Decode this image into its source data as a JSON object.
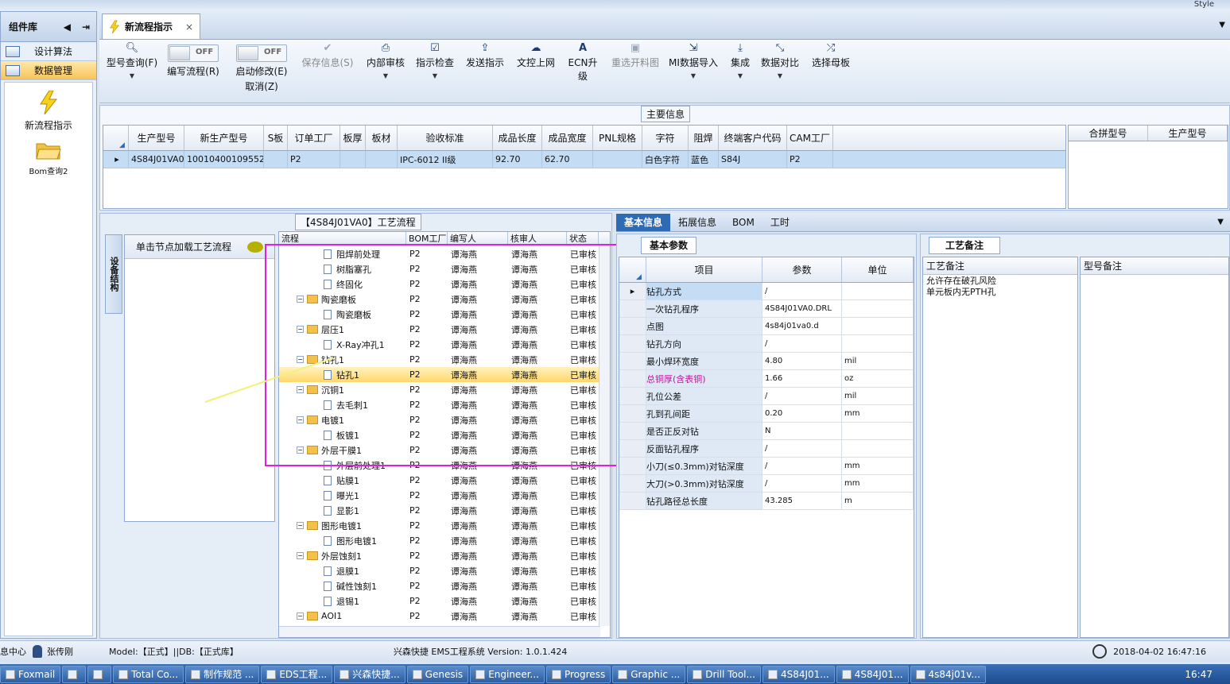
{
  "window": {
    "style_label": "Style"
  },
  "sidebar": {
    "title": "组件库",
    "prev": "◀",
    "pin": "⇥",
    "buttons": [
      {
        "label": "设计算法"
      },
      {
        "label": "数据管理"
      }
    ],
    "items": [
      {
        "label": "新流程指示"
      },
      {
        "label": "Bom查询2"
      }
    ]
  },
  "tab": {
    "label": "新流程指示",
    "close": "×",
    "menu": "▼"
  },
  "toolbar": {
    "model_query": "型号查询(F)",
    "edit_flow": "编写流程(R)",
    "start_modify": "启动修改(E)",
    "cancel": "取消(Z)",
    "off": "OFF",
    "save": "保存信息(S)",
    "internal_review": "内部审核",
    "check": "指示检查",
    "send": "发送指示",
    "upload": "文控上网",
    "ecn": "ECN升级",
    "reselect": "重选开料图",
    "mi_import": "MI数据导入",
    "integrate": "集成",
    "compare": "数据对比",
    "select_board": "选择母板"
  },
  "main_info": {
    "title": "主要信息",
    "columns": [
      "生产型号",
      "新生产型号",
      "S板",
      "订单工厂",
      "板厚",
      "板材",
      "验收标准",
      "成品长度",
      "成品宽度",
      "PNL规格",
      "字符",
      "阻焊",
      "终端客户代码",
      "CAM工厂"
    ],
    "row": [
      "4S84J01VA0",
      "10010400109552",
      "",
      "P2",
      "",
      "",
      "IPC-6012 II级",
      "92.70",
      "62.70",
      "",
      "白色字符",
      "蓝色",
      "S84J",
      "P2"
    ],
    "side_columns": [
      "合拼型号",
      "生产型号"
    ]
  },
  "process": {
    "title": "【4S84J01VA0】工艺流程",
    "side_tab": "设备结构",
    "node_hint": "单击节点加载工艺流程",
    "columns": [
      "流程",
      "BOM工厂",
      "编写人",
      "核审人",
      "状态"
    ],
    "rows": [
      {
        "name": "阻焊前处理",
        "level": 2,
        "factory": "P2",
        "writer": "谭海燕",
        "reviewer": "谭海燕",
        "status": "已审核"
      },
      {
        "name": "树脂塞孔",
        "level": 2,
        "factory": "P2",
        "writer": "谭海燕",
        "reviewer": "谭海燕",
        "status": "已审核"
      },
      {
        "name": "终固化",
        "level": 2,
        "factory": "P2",
        "writer": "谭海燕",
        "reviewer": "谭海燕",
        "status": "已审核"
      },
      {
        "name": "陶瓷磨板",
        "level": 1,
        "factory": "P2",
        "writer": "谭海燕",
        "reviewer": "谭海燕",
        "status": "已审核"
      },
      {
        "name": "陶瓷磨板",
        "level": 2,
        "factory": "P2",
        "writer": "谭海燕",
        "reviewer": "谭海燕",
        "status": "已审核"
      },
      {
        "name": "层压1",
        "level": 1,
        "factory": "P2",
        "writer": "谭海燕",
        "reviewer": "谭海燕",
        "status": "已审核"
      },
      {
        "name": "X-Ray冲孔1",
        "level": 2,
        "factory": "P2",
        "writer": "谭海燕",
        "reviewer": "谭海燕",
        "status": "已审核"
      },
      {
        "name": "钻孔1",
        "level": 1,
        "factory": "P2",
        "writer": "谭海燕",
        "reviewer": "谭海燕",
        "status": "已审核"
      },
      {
        "name": "钻孔1",
        "level": 2,
        "factory": "P2",
        "writer": "谭海燕",
        "reviewer": "谭海燕",
        "status": "已审核",
        "selected": true
      },
      {
        "name": "沉铜1",
        "level": 1,
        "factory": "P2",
        "writer": "谭海燕",
        "reviewer": "谭海燕",
        "status": "已审核"
      },
      {
        "name": "去毛刺1",
        "level": 2,
        "factory": "P2",
        "writer": "谭海燕",
        "reviewer": "谭海燕",
        "status": "已审核"
      },
      {
        "name": "电镀1",
        "level": 1,
        "factory": "P2",
        "writer": "谭海燕",
        "reviewer": "谭海燕",
        "status": "已审核"
      },
      {
        "name": "板镀1",
        "level": 2,
        "factory": "P2",
        "writer": "谭海燕",
        "reviewer": "谭海燕",
        "status": "已审核"
      },
      {
        "name": "外层干膜1",
        "level": 1,
        "factory": "P2",
        "writer": "谭海燕",
        "reviewer": "谭海燕",
        "status": "已审核"
      },
      {
        "name": "外层前处理1",
        "level": 2,
        "factory": "P2",
        "writer": "谭海燕",
        "reviewer": "谭海燕",
        "status": "已审核"
      },
      {
        "name": "贴膜1",
        "level": 2,
        "factory": "P2",
        "writer": "谭海燕",
        "reviewer": "谭海燕",
        "status": "已审核"
      },
      {
        "name": "曝光1",
        "level": 2,
        "factory": "P2",
        "writer": "谭海燕",
        "reviewer": "谭海燕",
        "status": "已审核"
      },
      {
        "name": "显影1",
        "level": 2,
        "factory": "P2",
        "writer": "谭海燕",
        "reviewer": "谭海燕",
        "status": "已审核"
      },
      {
        "name": "图形电镀1",
        "level": 1,
        "factory": "P2",
        "writer": "谭海燕",
        "reviewer": "谭海燕",
        "status": "已审核"
      },
      {
        "name": "图形电镀1",
        "level": 2,
        "factory": "P2",
        "writer": "谭海燕",
        "reviewer": "谭海燕",
        "status": "已审核"
      },
      {
        "name": "外层蚀刻1",
        "level": 1,
        "factory": "P2",
        "writer": "谭海燕",
        "reviewer": "谭海燕",
        "status": "已审核"
      },
      {
        "name": "退膜1",
        "level": 2,
        "factory": "P2",
        "writer": "谭海燕",
        "reviewer": "谭海燕",
        "status": "已审核"
      },
      {
        "name": "碱性蚀刻1",
        "level": 2,
        "factory": "P2",
        "writer": "谭海燕",
        "reviewer": "谭海燕",
        "status": "已审核"
      },
      {
        "name": "退锡1",
        "level": 2,
        "factory": "P2",
        "writer": "谭海燕",
        "reviewer": "谭海燕",
        "status": "已审核"
      },
      {
        "name": "AOI1",
        "level": 1,
        "factory": "P2",
        "writer": "谭海燕",
        "reviewer": "谭海燕",
        "status": "已审核"
      }
    ]
  },
  "right_tabs": [
    {
      "label": "基本信息",
      "active": true
    },
    {
      "label": "拓展信息"
    },
    {
      "label": "BOM"
    },
    {
      "label": "工时"
    }
  ],
  "right_menu": "▼",
  "params": {
    "title": "基本参数",
    "columns": [
      "项目",
      "参数",
      "单位"
    ],
    "rows": [
      {
        "item": "钻孔方式",
        "value": "/",
        "unit": "",
        "selected": true
      },
      {
        "item": "一次钻孔程序",
        "value": "4S84J01VA0.DRL",
        "unit": ""
      },
      {
        "item": "点图",
        "value": "4s84j01va0.d",
        "unit": ""
      },
      {
        "item": "钻孔方向",
        "value": "/",
        "unit": ""
      },
      {
        "item": "最小焊环宽度",
        "value": "4.80",
        "unit": "mil"
      },
      {
        "item": "总铜厚(含表铜)",
        "value": "1.66",
        "unit": "oz",
        "highlight": true
      },
      {
        "item": "孔位公差",
        "value": "/",
        "unit": "mil"
      },
      {
        "item": "孔到孔间距",
        "value": "0.20",
        "unit": "mm"
      },
      {
        "item": "是否正反对钻",
        "value": "N",
        "unit": ""
      },
      {
        "item": "反面钻孔程序",
        "value": "/",
        "unit": ""
      },
      {
        "item": "小刀(≤0.3mm)对钻深度",
        "value": "/",
        "unit": "mm"
      },
      {
        "item": "大刀(>0.3mm)对钻深度",
        "value": "/",
        "unit": "mm"
      },
      {
        "item": "钻孔路径总长度",
        "value": "43.285",
        "unit": "m"
      }
    ]
  },
  "notes": {
    "title": "工艺备注",
    "process_label": "工艺备注",
    "model_label": "型号备注",
    "process_text_1": "允许存在破孔风险",
    "process_text_2": "单元板内无PTH孔"
  },
  "status": {
    "info_center": "息中心",
    "user": "张传刚",
    "model_db": "Model:【正式】||DB:【正式库】",
    "system": "兴森快捷 EMS工程系统 Version: 1.0.1.424",
    "datetime": "2018-04-02 16:47:16"
  },
  "taskbar": {
    "items": [
      "Foxmail",
      "",
      "",
      "Total Co...",
      "制作规范 ...",
      "EDS工程...",
      "兴森快捷...",
      "Genesis",
      "Engineer...",
      "Progress",
      "Graphic ...",
      "Drill Tool...",
      "4S84J01...",
      "4S84J01...",
      "4s84j01v..."
    ],
    "time": "16:47"
  }
}
